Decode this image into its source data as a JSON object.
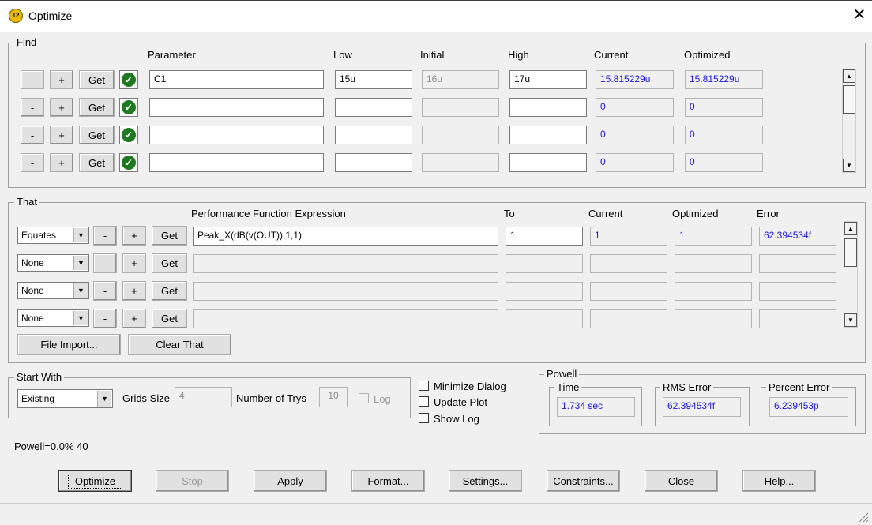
{
  "window": {
    "title": "Optimize",
    "icon_text": "12"
  },
  "find": {
    "group_label": "Find",
    "headers": {
      "parameter": "Parameter",
      "low": "Low",
      "initial": "Initial",
      "high": "High",
      "current": "Current",
      "optimized": "Optimized"
    },
    "minus_label": "-",
    "plus_label": "+",
    "get_label": "Get",
    "rows": [
      {
        "parameter": "C1",
        "low": "15u",
        "initial": "16u",
        "high": "17u",
        "current": "15.815229u",
        "optimized": "15.815229u"
      },
      {
        "parameter": "",
        "low": "",
        "initial": "",
        "high": "",
        "current": "0",
        "optimized": "0"
      },
      {
        "parameter": "",
        "low": "",
        "initial": "",
        "high": "",
        "current": "0",
        "optimized": "0"
      },
      {
        "parameter": "",
        "low": "",
        "initial": "",
        "high": "",
        "current": "0",
        "optimized": "0"
      }
    ]
  },
  "that": {
    "group_label": "That",
    "headers": {
      "expression": "Performance Function Expression",
      "to": "To",
      "current": "Current",
      "optimized": "Optimized",
      "error": "Error"
    },
    "minus_label": "-",
    "plus_label": "+",
    "get_label": "Get",
    "rows": [
      {
        "mode": "Equates",
        "expression": "Peak_X(dB(v(OUT)),1,1)",
        "to": "1",
        "current": "1",
        "optimized": "1",
        "error": "62.394534f"
      },
      {
        "mode": "None",
        "expression": "",
        "to": "",
        "current": "",
        "optimized": "",
        "error": ""
      },
      {
        "mode": "None",
        "expression": "",
        "to": "",
        "current": "",
        "optimized": "",
        "error": ""
      },
      {
        "mode": "None",
        "expression": "",
        "to": "",
        "current": "",
        "optimized": "",
        "error": ""
      }
    ],
    "file_import_label": "File Import...",
    "clear_that_label": "Clear That"
  },
  "start_with": {
    "group_label": "Start With",
    "mode": "Existing",
    "grids_size_label": "Grids Size",
    "grids_size_value": "4",
    "number_of_trys_label": "Number of Trys",
    "number_of_trys_value": "10",
    "log_label": "Log"
  },
  "options": {
    "minimize_dialog": "Minimize Dialog",
    "update_plot": "Update Plot",
    "show_log": "Show Log"
  },
  "powell": {
    "group_label": "Powell",
    "time_label": "Time",
    "time_value": "1.734 sec",
    "rms_label": "RMS Error",
    "rms_value": "62.394534f",
    "percent_label": "Percent Error",
    "percent_value": "6.239453p"
  },
  "status_text": "Powell=0.0% 40",
  "buttons": {
    "optimize": "Optimize",
    "stop": "Stop",
    "apply": "Apply",
    "format": "Format...",
    "settings": "Settings...",
    "constraints": "Constraints...",
    "close": "Close",
    "help": "Help..."
  },
  "colors": {
    "readonly_text": "#1a1adc",
    "check_green": "#1f7a1f"
  }
}
